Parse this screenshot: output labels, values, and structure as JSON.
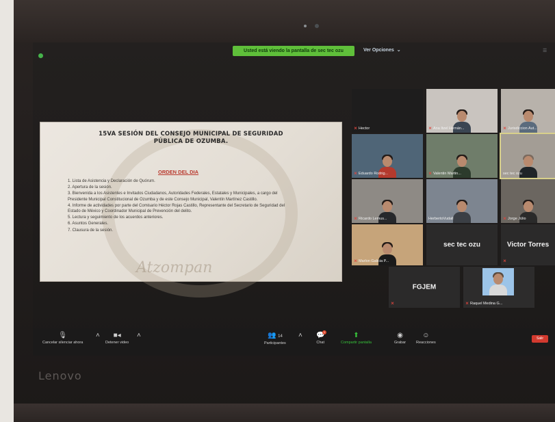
{
  "top_bar": {
    "viewing_banner": "Usted está viendo la pantalla de sec tec ozu",
    "view_options": "Ver Opciones"
  },
  "slide": {
    "title": "15VA SESIÓN DEL CONSEJO MUNICIPAL DE SEGURIDAD PÚBLICA DE OZUMBA.",
    "agenda_heading": "ORDEN DEL DIA",
    "agenda_items": [
      "1. Lista de Asistencia y Declaración de Quórum.",
      "2. Apertura de la sesión.",
      "3. Bienvenida a los Asistentes e Invitados Ciudadanos, Autoridades Federales, Estatales y Municipales, a cargo del Presidente Municipal Constitucional de Ozumba y de este Consejo Municipal, Valentín Martínez Castillo.",
      "4. Informe de actividades por parte del Comisario Héctor Rojas Castillo, Representante del Secretario de Seguridad del Estado de México y Coordinador Municipal de Prevención del delito.",
      "5. Lectura y seguimiento de los acuerdos anteriores.",
      "6. Asuntos Generales.",
      "7. Clausura de la sesión."
    ],
    "watermark": "Atzompan"
  },
  "participants": [
    {
      "name": "Hector",
      "muted": true
    },
    {
      "name": "Ana Itzel Hernán...",
      "muted": true
    },
    {
      "name": "Jurisdiccion Aut...",
      "muted": true
    },
    {
      "name": "Eduardo Rodrig...",
      "muted": true
    },
    {
      "name": "Valentin Martin...",
      "muted": true
    },
    {
      "name": "sec tec ozu",
      "muted": false
    },
    {
      "name": "Ricardo Lemus...",
      "muted": true
    },
    {
      "name": "HerbertoVudall",
      "muted": false
    },
    {
      "name": "Jorge Júlio",
      "muted": true
    },
    {
      "name": "Marlon Galicia P...",
      "muted": true
    },
    {
      "name": "sec tec ozu",
      "muted": false
    },
    {
      "name": "Victor Torres",
      "muted": true
    },
    {
      "name": "FGJEM",
      "muted": true
    },
    {
      "name": "Raquel Medina G...",
      "muted": true
    }
  ],
  "toolbar": {
    "mute_label": "Cancelar silenciar ahora",
    "video_label": "Detener video",
    "participants_label": "Participantes",
    "participants_count": "14",
    "chat_label": "Chat",
    "chat_badge": "1",
    "share_label": "Compartir pantalla",
    "record_label": "Grabar",
    "reactions_label": "Reacciones",
    "end_label": "Salir"
  },
  "device_brand": "Lenovo",
  "colors": {
    "banner_green": "#5fbf3a",
    "share_green": "#37c23a",
    "exit_red": "#d23a2f",
    "mic_muted_red": "#e0463e"
  }
}
